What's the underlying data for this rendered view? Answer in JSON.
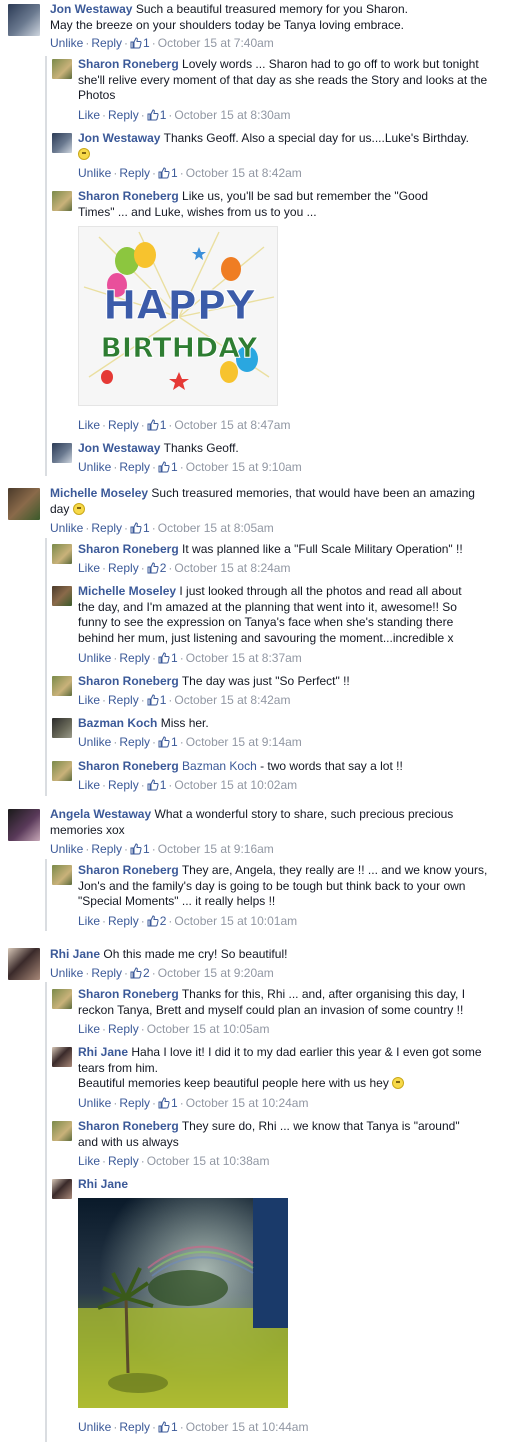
{
  "actions": {
    "like": "Like",
    "unlike": "Unlike",
    "reply": "Reply",
    "sep": "·"
  },
  "colors": {
    "link": "#3b5998",
    "meta": "#9197a3",
    "rail": "#dadde1"
  },
  "comments": [
    {
      "author": "Jon Westaway",
      "text": "Such a beautiful treasured memory for you Sharon.",
      "text2": "May the breeze on your shoulders today be Tanya loving embrace.",
      "likes": "1",
      "time": "October 15 at 7:40am"
    },
    {
      "author": "Sharon Roneberg",
      "text": "Lovely words ... Sharon had to go off to work but tonight she'll relive every moment of that day as she reads the Story and looks at the Photos",
      "likes": "1",
      "time": "October 15 at 8:30am"
    },
    {
      "author": "Jon Westaway",
      "text": "Thanks Geoff. Also a special day for us....Luke's Birthday.",
      "likes": "1",
      "time": "October 15 at 8:42am"
    },
    {
      "author": "Sharon Roneberg",
      "text": "Like us, you'll be sad but remember the \"Good Times\" ... and Luke, wishes from us to you ...",
      "likes": "1",
      "time": "October 15 at 8:47am",
      "image": {
        "line1": "HAPPY",
        "line2": "BIRTHDAY"
      }
    },
    {
      "author": "Jon Westaway",
      "text": "Thanks Geoff.",
      "likes": "1",
      "time": "October 15 at 9:10am"
    },
    {
      "author": "Michelle Moseley",
      "text": "Such treasured memories, that would have been an amazing day",
      "likes": "1",
      "time": "October 15 at 8:05am"
    },
    {
      "author": "Sharon Roneberg",
      "text": "It was planned like a \"Full Scale Military Operation\" !!",
      "likes": "2",
      "time": "October 15 at 8:24am"
    },
    {
      "author": "Michelle Moseley",
      "text": "I just looked through all the photos and read all about the day, and I'm amazed at the planning that went into it, awesome!! So funny to see the expression on Tanya's face when she's standing there behind her mum, just listening and savouring the moment...incredible x",
      "likes": "1",
      "time": "October 15 at 8:37am"
    },
    {
      "author": "Sharon Roneberg",
      "text": "The day was just \"So Perfect\" !!",
      "likes": "1",
      "time": "October 15 at 8:42am"
    },
    {
      "author": "Bazman Koch",
      "text": "Miss her.",
      "likes": "1",
      "time": "October 15 at 9:14am"
    },
    {
      "author": "Sharon Roneberg",
      "mention": "Bazman Koch",
      "text": " - two words that say a lot !!",
      "likes": "1",
      "time": "October 15 at 10:02am"
    },
    {
      "author": "Angela Westaway",
      "text": "What a wonderful story to share, such precious precious memories xox",
      "likes": "1",
      "time": "October 15 at 9:16am"
    },
    {
      "author": "Sharon Roneberg",
      "text": "They are, Angela, they really are !! ... and we know yours, Jon's and the family's day is going to be tough but think back to your own \"Special Moments\" ... it really helps !!",
      "likes": "2",
      "time": "October 15 at 10:01am"
    },
    {
      "author": "Rhi Jane",
      "text": "Oh this made me cry! So beautiful!",
      "likes": "2",
      "time": "October 15 at 9:20am"
    },
    {
      "author": "Sharon Roneberg",
      "text": "Thanks for this, Rhi ... and, after organising this day, I reckon Tanya, Brett and myself could plan an invasion of some country !!",
      "likes": "",
      "time": "October 15 at 10:05am"
    },
    {
      "author": "Rhi Jane",
      "text": "Haha I love it! I did it to my dad earlier this year & I even got some tears from him.",
      "text2": "Beautiful memories keep beautiful people here with us hey",
      "likes": "1",
      "time": "October 15 at 10:24am"
    },
    {
      "author": "Sharon Roneberg",
      "text": "They sure do, Rhi ... we know that Tanya is \"around\" and with us always",
      "likes": "",
      "time": "October 15 at 10:38am"
    },
    {
      "author": "Rhi Jane",
      "text": "",
      "likes": "1",
      "time": "October 15 at 10:44am"
    }
  ]
}
